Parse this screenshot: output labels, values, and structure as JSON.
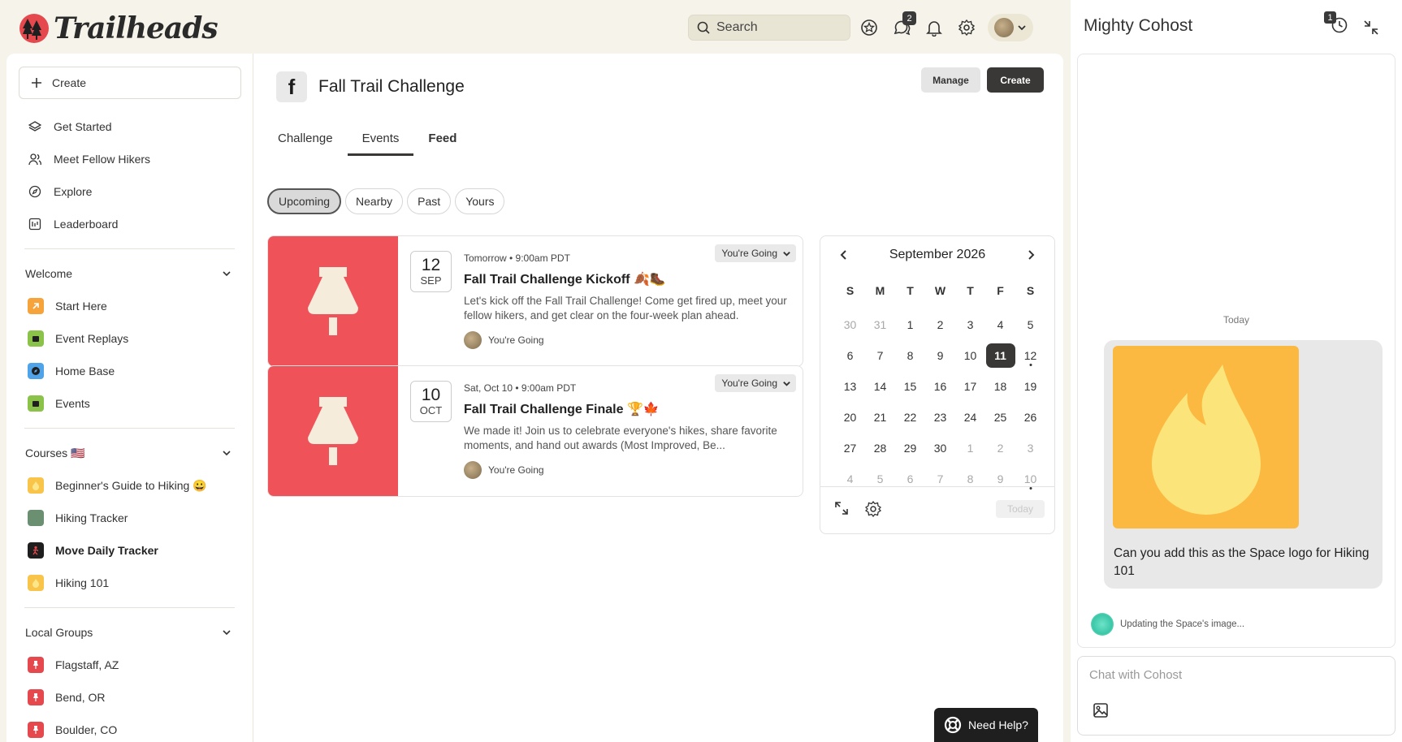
{
  "brand": {
    "name": "Trailheads"
  },
  "search": {
    "placeholder": "Search"
  },
  "topbar": {
    "chat_badge": "2"
  },
  "sidebar": {
    "create_label": "Create",
    "items": [
      {
        "label": "Get Started"
      },
      {
        "label": "Meet Fellow Hikers"
      },
      {
        "label": "Explore"
      },
      {
        "label": "Leaderboard"
      }
    ],
    "sections": [
      {
        "title": "Welcome",
        "items": [
          {
            "label": "Start Here",
            "color": "#f7a33b"
          },
          {
            "label": "Event Replays",
            "color": "#8bc34a"
          },
          {
            "label": "Home Base",
            "color": "#4fa3e8"
          },
          {
            "label": "Events",
            "color": "#8bc34a"
          }
        ]
      },
      {
        "title": "Courses 🇺🇸",
        "items": [
          {
            "label": "Beginner's Guide to Hiking 😀",
            "color": "#f8c44a"
          },
          {
            "label": "Hiking Tracker",
            "color": "#6b8f71"
          },
          {
            "label": "Move Daily Tracker",
            "color": "#1e1e1e"
          },
          {
            "label": "Hiking 101",
            "color": "#f8c44a"
          }
        ]
      },
      {
        "title": "Local Groups",
        "items": [
          {
            "label": "Flagstaff, AZ",
            "color": "#e5484d"
          },
          {
            "label": "Bend, OR",
            "color": "#e5484d"
          },
          {
            "label": "Boulder, CO",
            "color": "#e5484d"
          }
        ]
      }
    ]
  },
  "space": {
    "title": "Fall Trail Challenge",
    "manage_label": "Manage",
    "create_label": "Create",
    "tabs": [
      {
        "label": "Challenge"
      },
      {
        "label": "Events"
      },
      {
        "label": "Feed"
      }
    ]
  },
  "filters": [
    {
      "label": "Upcoming"
    },
    {
      "label": "Nearby"
    },
    {
      "label": "Past"
    },
    {
      "label": "Yours"
    }
  ],
  "events": [
    {
      "day": "12",
      "month": "SEP",
      "meta": "Tomorrow • 9:00am PDT",
      "title": "Fall Trail Challenge Kickoff 🍂🥾",
      "description": "Let's kick off the Fall Trail Challenge! Come get fired up, meet your fellow hikers, and get clear on the four-week plan ahead.",
      "rsvp": "You're Going",
      "going_label": "You're Going"
    },
    {
      "day": "10",
      "month": "OCT",
      "meta": "Sat, Oct 10 • 9:00am PDT",
      "title": "Fall Trail Challenge Finale 🏆🍁",
      "description": "We made it! Join us to celebrate everyone's hikes, share favorite moments, and hand out awards (Most Improved, Be...",
      "rsvp": "You're Going",
      "going_label": "You're Going"
    }
  ],
  "calendar": {
    "month": "September 2026",
    "dow": [
      "S",
      "M",
      "T",
      "W",
      "T",
      "F",
      "S"
    ],
    "weeks": [
      [
        "30",
        "31",
        "1",
        "2",
        "3",
        "4",
        "5"
      ],
      [
        "6",
        "7",
        "8",
        "9",
        "10",
        "11",
        "12"
      ],
      [
        "13",
        "14",
        "15",
        "16",
        "17",
        "18",
        "19"
      ],
      [
        "20",
        "21",
        "22",
        "23",
        "24",
        "25",
        "26"
      ],
      [
        "27",
        "28",
        "29",
        "30",
        "1",
        "2",
        "3"
      ],
      [
        "4",
        "5",
        "6",
        "7",
        "8",
        "9",
        "10"
      ]
    ],
    "today_label": "Today"
  },
  "help": {
    "label": "Need Help?"
  },
  "cohost": {
    "title": "Mighty Cohost",
    "history_badge": "1",
    "day_label": "Today",
    "message": "Can you add this as the Space logo for Hiking 101",
    "status": "Updating the Space's image...",
    "input_placeholder": "Chat with Cohost"
  }
}
